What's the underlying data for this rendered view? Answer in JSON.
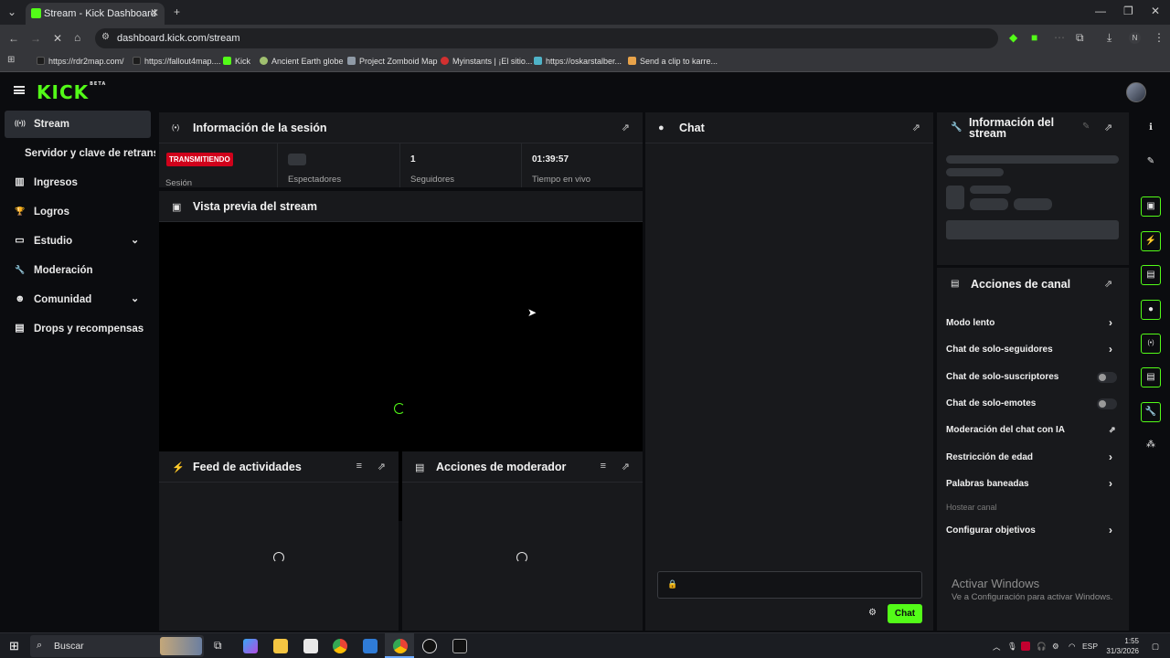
{
  "browser": {
    "tab_title": "Stream - Kick Dashboard",
    "tab_close": "✕",
    "new_tab": "+",
    "url": "dashboard.kick.com/stream",
    "profile_initial": "N",
    "bookmarks": [
      {
        "label": "https://rdr2map.com/",
        "color": "#1d1d1d"
      },
      {
        "label": "https://fallout4map....",
        "color": "#1d1d1d"
      },
      {
        "label": "Kick",
        "color": "#53fc18"
      },
      {
        "label": "Ancient Earth globe",
        "color": "#a0c070"
      },
      {
        "label": "Project Zomboid Map",
        "color": "#8f9aa6"
      },
      {
        "label": "Myinstants | ¡El sitio...",
        "color": "#d23030"
      },
      {
        "label": "https://oskarstalber...",
        "color": "#4fb3c8"
      },
      {
        "label": "Send a clip to karre...",
        "color": "#e8a34a"
      }
    ]
  },
  "app": {
    "logo": "KICK",
    "logo_sup": "BETA",
    "sidebar": [
      {
        "label": "Stream",
        "icon": "((•))",
        "active": true,
        "chevron": false
      },
      {
        "label": "Servidor y clave de retransmisión",
        "icon": "",
        "active": false,
        "chevron": false
      },
      {
        "label": "Ingresos",
        "icon": "▥",
        "active": false,
        "chevron": false
      },
      {
        "label": "Logros",
        "icon": "🏆",
        "active": false,
        "chevron": false
      },
      {
        "label": "Estudio",
        "icon": "▭",
        "active": false,
        "chevron": true
      },
      {
        "label": "Moderación",
        "icon": "🔧",
        "active": false,
        "chevron": false
      },
      {
        "label": "Comunidad",
        "icon": "☻",
        "active": false,
        "chevron": true
      },
      {
        "label": "Drops y recompensas",
        "icon": "▤",
        "active": false,
        "chevron": false
      }
    ],
    "session": {
      "title": "Información de la sesión",
      "status_badge": "TRANSMITIENDO",
      "session_label": "Sesión",
      "viewers_label": "Espectadores",
      "followers_value": "1",
      "followers_label": "Seguidores",
      "live_time_value": "01:39:57",
      "live_time_label": "Tiempo en vivo"
    },
    "preview": {
      "title": "Vista previa del stream"
    },
    "feed": {
      "title": "Feed de actividades"
    },
    "mod_actions": {
      "title": "Acciones de moderador"
    },
    "chat": {
      "title": "Chat",
      "send_label": "Chat",
      "accent": "#53fc18"
    },
    "stream_info": {
      "title": "Información del stream"
    },
    "channel_actions": {
      "title": "Acciones de canal",
      "items": [
        {
          "label": "Modo lento",
          "kind": "chevron"
        },
        {
          "label": "Chat de solo-seguidores",
          "kind": "chevron"
        },
        {
          "label": "Chat de solo-suscriptores",
          "kind": "toggle"
        },
        {
          "label": "Chat de solo-emotes",
          "kind": "toggle"
        },
        {
          "label": "Moderación del chat con IA",
          "kind": "external"
        },
        {
          "label": "Restricción de edad",
          "kind": "chevron"
        },
        {
          "label": "Palabras baneadas",
          "kind": "chevron"
        },
        {
          "label": "Hostear canal",
          "kind": "disabled"
        },
        {
          "label": "Configurar objetivos",
          "kind": "chevron"
        }
      ]
    },
    "watermark": {
      "line1": "Activar Windows",
      "line2": "Ve a Configuración para activar Windows."
    }
  },
  "taskbar": {
    "search_placeholder": "Buscar",
    "language": "ESP",
    "time": "1:55",
    "date": "31/3/2026"
  }
}
